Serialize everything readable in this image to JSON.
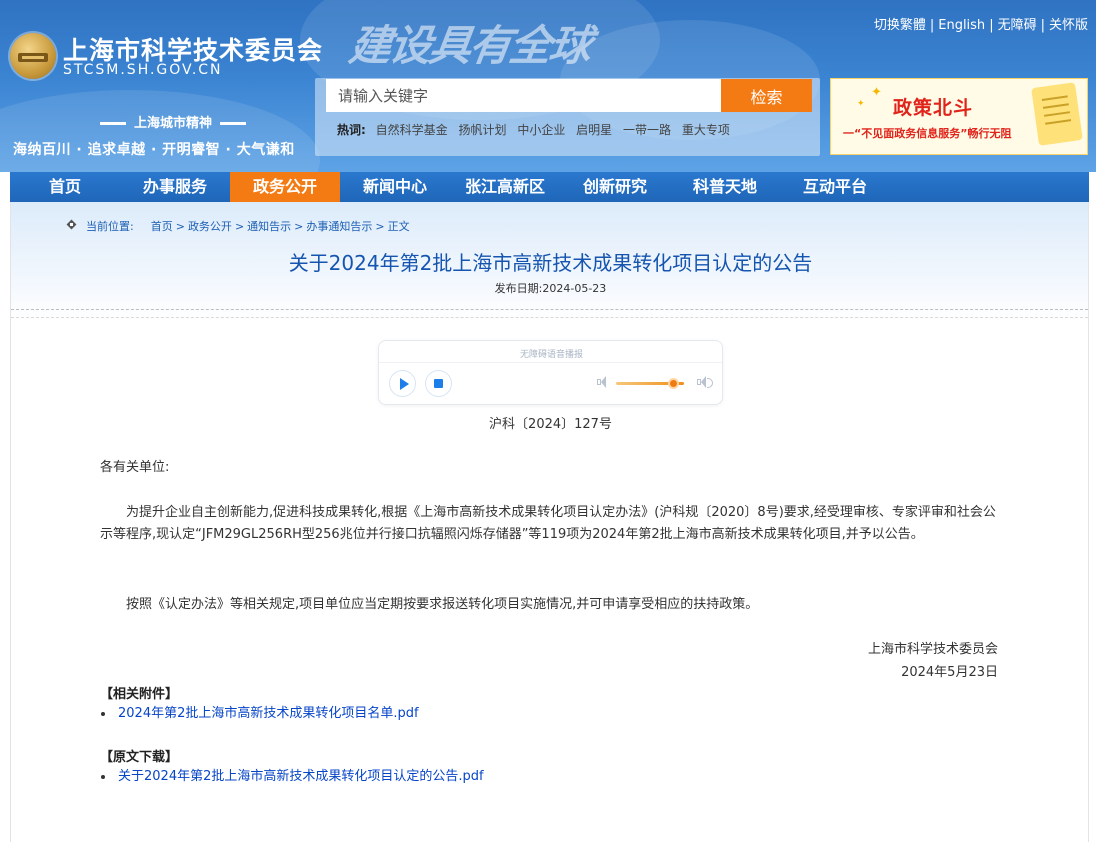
{
  "header": {
    "site_title": "上海市科学技术委员会",
    "site_domain": "STCSM.SH.GOV.CN",
    "calligraphy": "建设具有全球",
    "top_links": [
      "切换繁體",
      "English",
      "无障碍",
      "关怀版"
    ],
    "city_spirit_title": "上海城市精神",
    "city_spirit_text": "海纳百川 · 追求卓越 · 开明睿智 · 大气谦和"
  },
  "search": {
    "placeholder": "请输入关键字",
    "button_label": "检索",
    "hot_label": "热词:",
    "hot_words": [
      "自然科学基金",
      "扬帆计划",
      "中小企业",
      "启明星",
      "一带一路",
      "重大专项"
    ]
  },
  "banner": {
    "title": "政策北斗",
    "subtitle": "一“不见面政务信息服务”畅行无阻"
  },
  "nav": {
    "items": [
      "首页",
      "办事服务",
      "政务公开",
      "新闻中心",
      "张江高新区",
      "创新研究",
      "科普天地",
      "互动平台"
    ],
    "active_index": 2
  },
  "breadcrumb": {
    "label": "当前位置:",
    "items": [
      "首页",
      "政务公开",
      "通知告示",
      "办事通知告示",
      "正文"
    ]
  },
  "article": {
    "title": "关于2024年第2批上海市高新技术成果转化项目认定的公告",
    "publish_date": "发布日期:2024-05-23",
    "doc_number": "沪科〔2024〕127号",
    "salutation": "各有关单位:",
    "paragraphs": [
      "为提升企业自主创新能力,促进科技成果转化,根据《上海市高新技术成果转化项目认定办法》(沪科规〔2020〕8号)要求,经受理审核、专家评审和社会公示等程序,现认定“JFM29GL256RH型256兆位并行接口抗辐照闪烁存储器”等119项为2024年第2批上海市高新技术成果转化项目,并予以公告。",
      "按照《认定办法》等相关规定,项目单位应当定期按要求报送转化项目实施情况,并可申请享受相应的扶持政策。"
    ],
    "signature_org": "上海市科学技术委员会",
    "signature_date": "2024年5月23日",
    "attachments_heading": "【相关附件】",
    "attachments": [
      "2024年第2批上海市高新技术成果转化项目名单.pdf"
    ],
    "original_heading": "【原文下载】",
    "original_files": [
      "关于2024年第2批上海市高新技术成果转化项目认定的公告.pdf"
    ]
  },
  "audio_player": {
    "label": "无障碍语音播报",
    "volume": 0.8
  },
  "colors": {
    "nav_active": "#f47b13",
    "title_blue": "#1555b0",
    "link_blue": "#0645c8",
    "header_blue": "#3b84d2"
  },
  "icons": [
    "breadcrumb-location-icon",
    "play-icon",
    "stop-icon",
    "volume-low-icon",
    "volume-high-icon",
    "emblem-logo"
  ]
}
